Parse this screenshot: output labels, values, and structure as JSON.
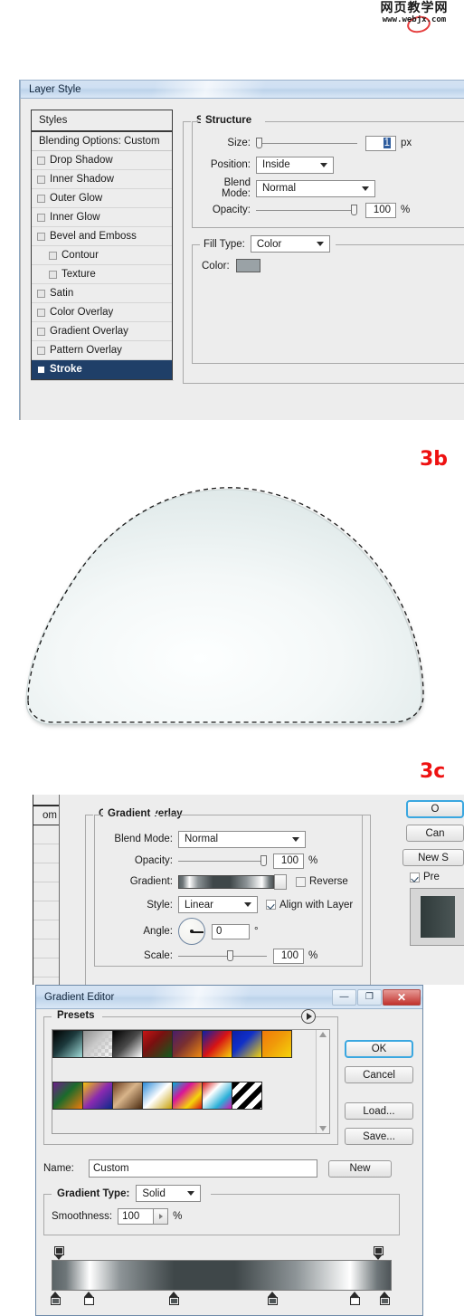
{
  "watermark": {
    "cn": "网页教学网",
    "url": "www.webjx.com"
  },
  "labels": {
    "step_3b": "3b",
    "step_3c": "3c"
  },
  "layer_style": {
    "title": "Layer Style",
    "styles_header": "Styles",
    "blending_options": "Blending Options: Custom",
    "effects": [
      {
        "label": "Drop Shadow",
        "checked": false,
        "indent": false
      },
      {
        "label": "Inner Shadow",
        "checked": false,
        "indent": false
      },
      {
        "label": "Outer Glow",
        "checked": false,
        "indent": false
      },
      {
        "label": "Inner Glow",
        "checked": false,
        "indent": false
      },
      {
        "label": "Bevel and Emboss",
        "checked": false,
        "indent": false
      },
      {
        "label": "Contour",
        "checked": false,
        "indent": true
      },
      {
        "label": "Texture",
        "checked": false,
        "indent": true
      },
      {
        "label": "Satin",
        "checked": false,
        "indent": false
      },
      {
        "label": "Color Overlay",
        "checked": false,
        "indent": false
      },
      {
        "label": "Gradient Overlay",
        "checked": false,
        "indent": false
      },
      {
        "label": "Pattern Overlay",
        "checked": false,
        "indent": false
      },
      {
        "label": "Stroke",
        "checked": true,
        "indent": false,
        "selected": true
      }
    ],
    "stroke": {
      "group_title": "Stroke",
      "structure_title": "Structure",
      "size_label": "Size:",
      "size_value": "1",
      "size_unit": "px",
      "position_label": "Position:",
      "position_value": "Inside",
      "blend_mode_label": "Blend Mode:",
      "blend_mode_value": "Normal",
      "opacity_label": "Opacity:",
      "opacity_value": "100",
      "opacity_unit": "%",
      "fill_type_label": "Fill Type:",
      "fill_type_value": "Color",
      "color_label": "Color:",
      "color_value": "#9aa2a6"
    }
  },
  "gradient_overlay": {
    "group_title": "Gradient Overlay",
    "sub_title": "Gradient",
    "blend_mode_label": "Blend Mode:",
    "blend_mode_value": "Normal",
    "opacity_label": "Opacity:",
    "opacity_value": "100",
    "opacity_unit": "%",
    "gradient_label": "Gradient:",
    "reverse_label": "Reverse",
    "reverse_checked": false,
    "style_label": "Style:",
    "style_value": "Linear",
    "align_label": "Align with Layer",
    "align_checked": true,
    "angle_label": "Angle:",
    "angle_value": "0",
    "angle_unit": "°",
    "scale_label": "Scale:",
    "scale_value": "100",
    "scale_unit": "%",
    "side_list_visible_text": "om",
    "buttons": [
      {
        "label": "O",
        "full": "OK",
        "primary": true
      },
      {
        "label": "Can",
        "full": "Cancel",
        "primary": false
      },
      {
        "label": "New S",
        "full": "New Style",
        "primary": false
      }
    ],
    "preview_label": "Pre",
    "preview_checked": true
  },
  "gradient_editor": {
    "title": "Gradient Editor",
    "window_buttons": {
      "minimize": "—",
      "maximize": "❐",
      "close": "✕"
    },
    "presets_title": "Presets",
    "presets": [
      "linear-gradient(135deg,#000 0%,#1d3a3d 45%,#9fdbd8 100%)",
      "linear-gradient(135deg,#8d8d8d 0%, #c9c9c9 45%, rgba(255,255,255,0) 100%)",
      "linear-gradient(135deg,#000 0%,#4a4a4a 50%,#ffffff 100%)",
      "linear-gradient(135deg,#c81414 0%,#7a1010 40%,#0f5c1c 100%)",
      "linear-gradient(135deg,#4a1d6b 0%,#7a3030 45%,#f08a10 100%)",
      "linear-gradient(135deg,#0b1fa8 0%,#d81414 50%,#f5d40a 100%)",
      "linear-gradient(135deg,#0b1fa8 0%,#1030c8 40%,#f5d40a 100%)",
      "linear-gradient(135deg,#f07a0a 0%,#f09a0a 45%,#f5d40a 100%)",
      "linear-gradient(135deg,#6b1d8a 0%,#1b6b2b 45%,#f07a0a 100%)",
      "linear-gradient(135deg,#f5c40a 0%,#8a2ab0 50%,#0b2a8a 100%)",
      "linear-gradient(135deg,#6b3a1d 0%,#d8b48a 45%,#4a2a10 100%)",
      "linear-gradient(135deg,#2a8ad8 0%,#ffffff 50%,#c8a00a 100%)",
      "linear-gradient(135deg,#00b0d8 0%,#d81498 35%,#f5d40a 70%,#d81414 100%)",
      "linear-gradient(135deg,#d81414 0%,#ffffff 35%,#2ab0d8 70%,#d814b0 100%)",
      "repeating-linear-gradient(135deg,#000 0 6px,#fff 6px 12px)"
    ],
    "name_label": "Name:",
    "name_value": "Custom",
    "new_button": "New",
    "gradient_type_label": "Gradient Type:",
    "gradient_type_value": "Solid",
    "smoothness_label": "Smoothness:",
    "smoothness_value": "100",
    "smoothness_unit": "%",
    "buttons": [
      {
        "label": "OK",
        "primary": true
      },
      {
        "label": "Cancel",
        "primary": false
      },
      {
        "label": "Load...",
        "primary": false
      },
      {
        "label": "Save...",
        "primary": false
      }
    ],
    "gradient_stops": {
      "css": "linear-gradient(to right,#5a6366 0%,#6e7679 4%,#ffffff 11%,#8d9497 20%,#3f4749 36%,#3f4749 54%,#8d9497 72%,#ffffff 88%,#6e7679 96%,#4f5558 100%)",
      "opacity_stops": [
        {
          "pos": 2,
          "color": "#2f2f2f"
        },
        {
          "pos": 96,
          "color": "#2f2f2f"
        }
      ],
      "color_stops": [
        {
          "pos": 1,
          "color": "#5a5f61"
        },
        {
          "pos": 11,
          "color": "#ffffff"
        },
        {
          "pos": 36,
          "color": "#4f5658"
        },
        {
          "pos": 65,
          "color": "#4f5658"
        },
        {
          "pos": 89,
          "color": "#ffffff"
        },
        {
          "pos": 98,
          "color": "#5a5f61"
        }
      ]
    }
  }
}
